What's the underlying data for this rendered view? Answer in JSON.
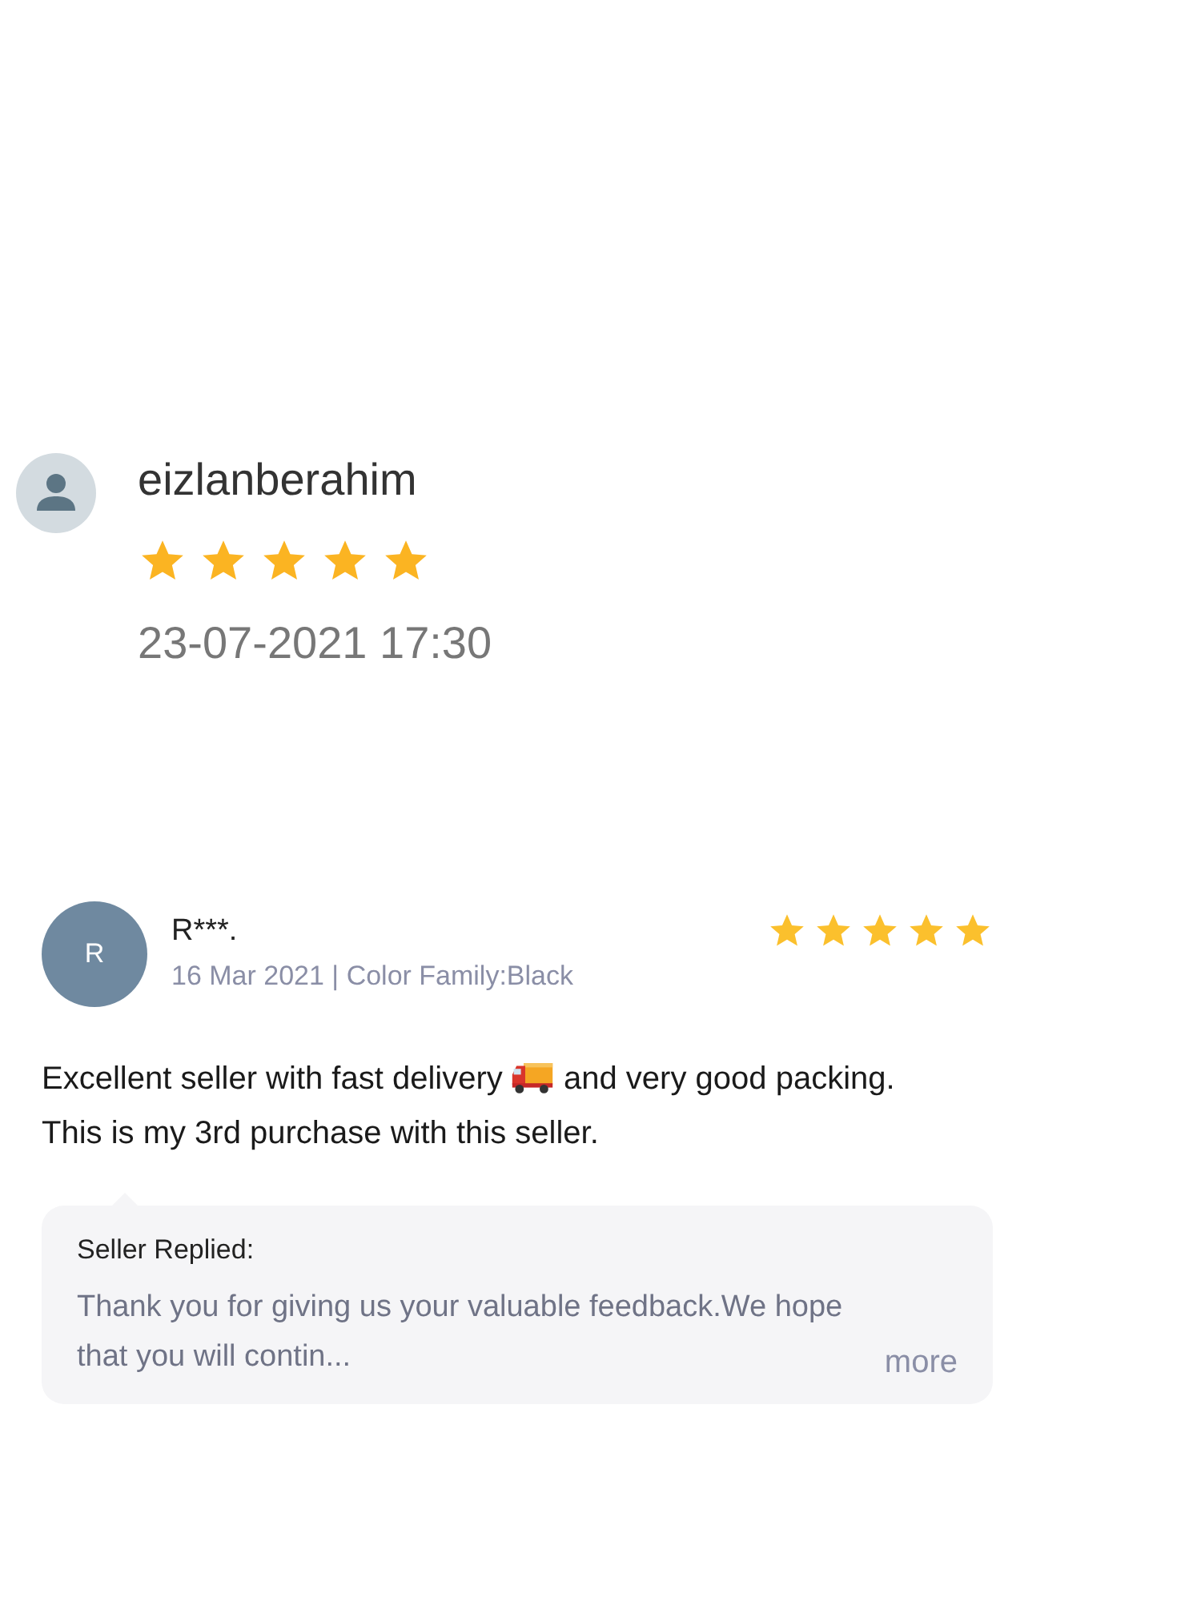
{
  "reviews": [
    {
      "kind": "profile",
      "name": "eizlanberahim",
      "stars": 5,
      "date": "23-07-2021 17:30"
    },
    {
      "kind": "initial",
      "initial": "R",
      "name": "R***.",
      "stars": 5,
      "meta": "16 Mar 2021 | Color Family:Black",
      "text_before": "Excellent seller with fast delivery",
      "text_after": "and very good packing. This is my 3rd purchase with this seller.",
      "reply": {
        "label": "Seller Replied:",
        "text": "Thank you for giving us your valuable feedback.We hope that you will contin...",
        "more": "more"
      }
    }
  ]
}
